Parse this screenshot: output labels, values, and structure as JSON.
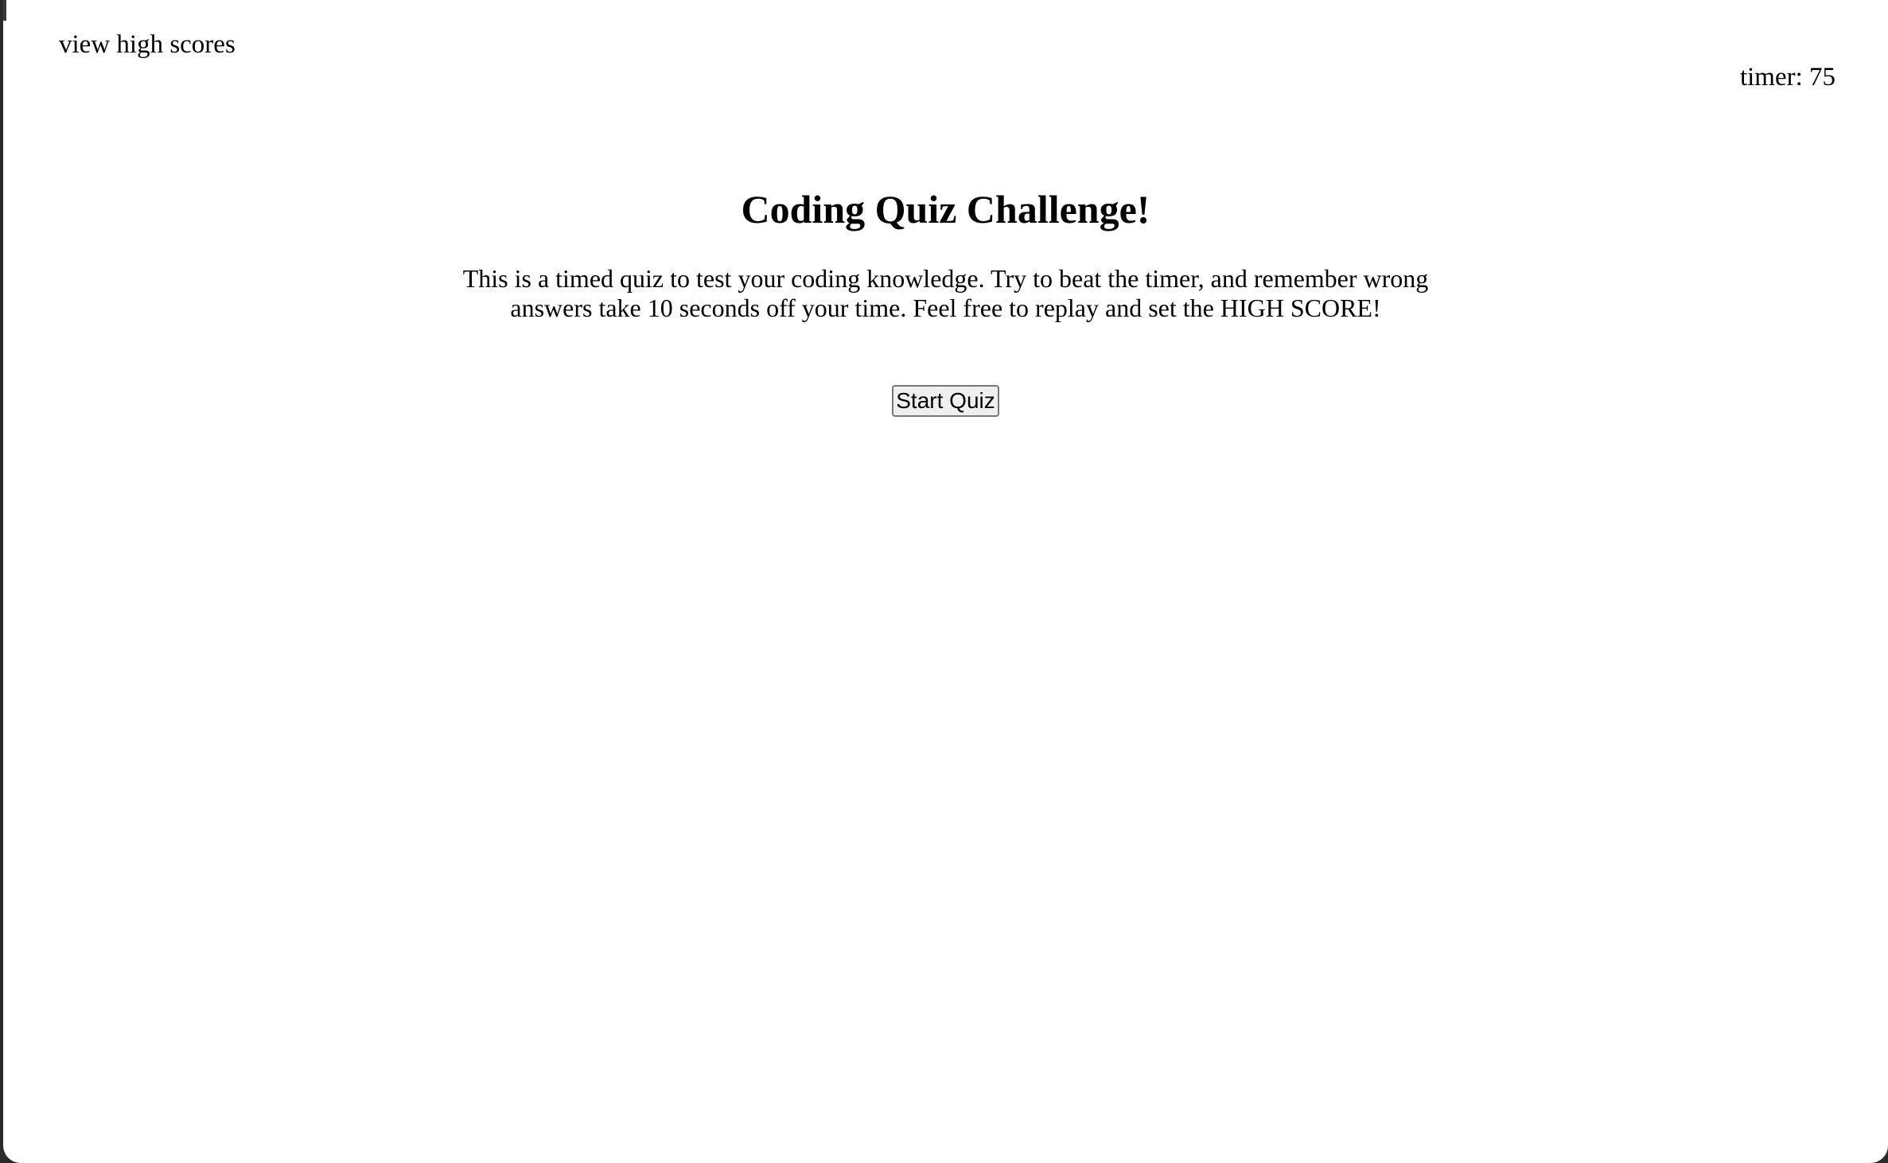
{
  "header": {
    "high_scores_label": "view high scores",
    "timer_text": "timer: 75"
  },
  "main": {
    "title": "Coding Quiz Challenge!",
    "description": "This is a timed quiz to test your coding knowledge. Try to beat the timer, and remember wrong answers take 10 seconds off your time. Feel free to replay and set the HIGH SCORE!",
    "start_button_label": "Start Quiz"
  },
  "colors": {
    "background": "#ffffff",
    "text": "#000000",
    "window_frame": "#2b2b2b",
    "button_background": "#efefef"
  }
}
